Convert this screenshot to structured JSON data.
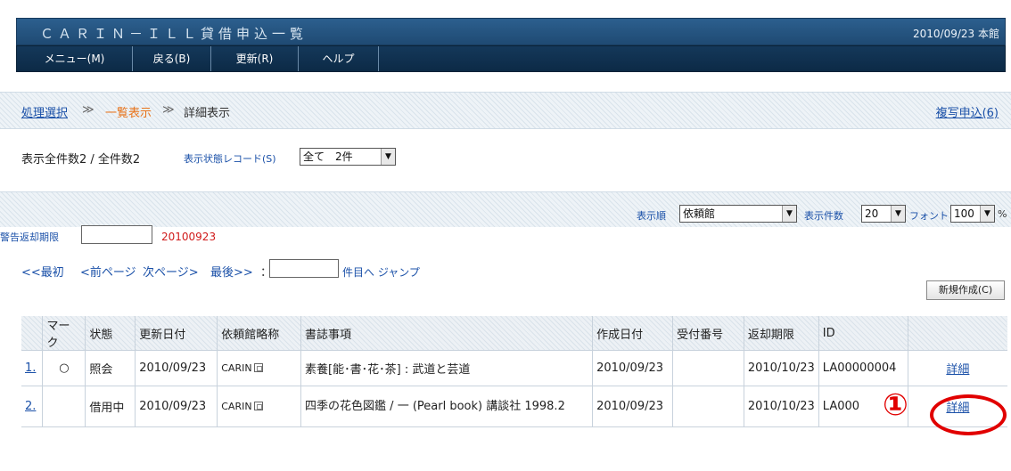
{
  "header": {
    "title": "ＣＡＲＩＮ－ＩＬＬ貸借申込一覧",
    "date_location": "2010/09/23 本館"
  },
  "menu": [
    {
      "label": "メニュー(M)"
    },
    {
      "label": "戻る(B)"
    },
    {
      "label": "更新(R)"
    },
    {
      "label": "ヘルプ"
    }
  ],
  "breadcrumb": {
    "step1": "処理選択",
    "sep": "≫",
    "step2": "一覧表示",
    "step3": "詳細表示",
    "copy_request": "複写申込(6)"
  },
  "status": {
    "count_text": "表示全件数2 / 全件数2",
    "record_label": "表示状態レコード(S)",
    "record_value": "全て　2件"
  },
  "options": {
    "order_label": "表示順",
    "order_value": "依頼館",
    "count_label": "表示件数",
    "count_value": "20",
    "font_label": "フォント",
    "font_value": "100",
    "pct": "%"
  },
  "warning": {
    "label": "警告返却期限",
    "input_value": "",
    "date": "20100923"
  },
  "pager": {
    "first": "<<最初",
    "prev": "<前ページ",
    "next": "次ページ>",
    "last": "最後>>",
    "colon": "：",
    "jump_text": "件目へ ジャンプ"
  },
  "new_button": "新規作成(C)",
  "table": {
    "headers": [
      "",
      "マーク",
      "状態",
      "更新日付",
      "依頼館略称",
      "書誌事項",
      "作成日付",
      "受付番号",
      "返却期限",
      "ID",
      ""
    ],
    "rows": [
      {
        "num": "1.",
        "mark": "○",
        "state": "照会",
        "updated": "2010/09/23",
        "library": "CARIN",
        "biblio": "素養[能･書･花･茶] : 武道と芸道",
        "created": "2010/09/23",
        "receipt": "",
        "due": "2010/10/23",
        "id": "LA00000004",
        "action": "詳細"
      },
      {
        "num": "2.",
        "mark": "",
        "state": "借用中",
        "updated": "2010/09/23",
        "library": "CARIN",
        "biblio": "四季の花色図鑑 / 一 (Pearl book) 講談社 1998.2",
        "created": "2010/09/23",
        "receipt": "",
        "due": "2010/10/23",
        "id": "LA000",
        "action": "詳細"
      }
    ]
  },
  "annotation": {
    "marker": "①",
    "color": "#e10000"
  }
}
